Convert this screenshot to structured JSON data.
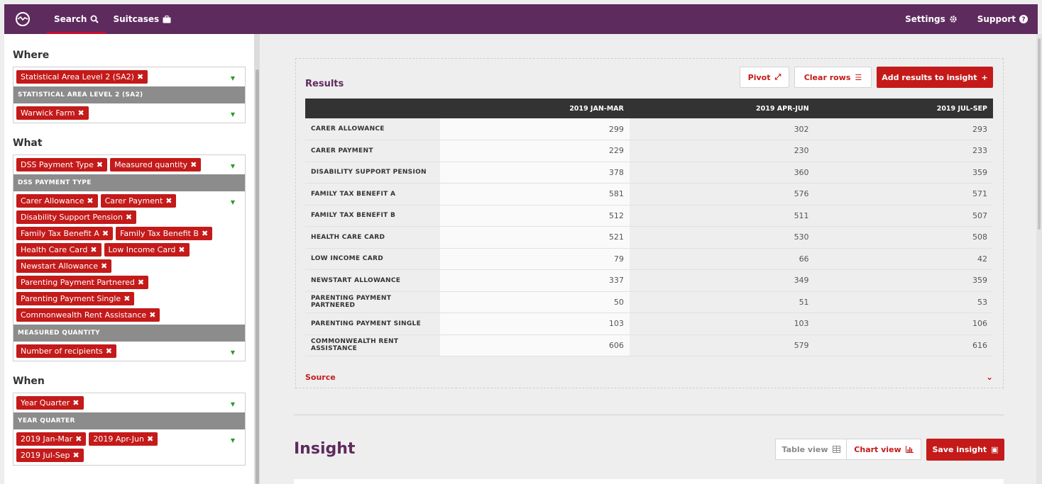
{
  "nav": {
    "search_label": "Search",
    "suitcases_label": "Suitcases",
    "settings_label": "Settings",
    "support_label": "Support",
    "active_color": "#c8102e",
    "bar_color": "#5e2b5e"
  },
  "sidebar": {
    "where": {
      "heading": "Where",
      "level_tags": [
        "Statistical Area Level 2 (SA2)"
      ],
      "group_label": "STATISTICAL AREA LEVEL 2 (SA2)",
      "area_tags": [
        "Warwick Farm"
      ]
    },
    "what": {
      "heading": "What",
      "dim_tags": [
        "DSS Payment Type",
        "Measured quantity"
      ],
      "group1_label": "DSS PAYMENT TYPE",
      "payment_tags": [
        "Carer Allowance",
        "Carer Payment",
        "Disability Support Pension",
        "Family Tax Benefit A",
        "Family Tax Benefit B",
        "Health Care Card",
        "Low Income Card",
        "Newstart Allowance",
        "Parenting Payment Partnered",
        "Parenting Payment Single",
        "Commonwealth Rent Assistance"
      ],
      "group2_label": "MEASURED QUANTITY",
      "quantity_tags": [
        "Number of recipients"
      ]
    },
    "when": {
      "heading": "When",
      "dim_tags": [
        "Year Quarter"
      ],
      "group_label": "YEAR QUARTER",
      "quarter_tags": [
        "2019 Jan-Mar",
        "2019 Apr-Jun",
        "2019 Jul-Sep"
      ]
    }
  },
  "results": {
    "title": "Results",
    "pivot_label": "Pivot",
    "clear_rows_label": "Clear rows",
    "add_label": "Add results to insight",
    "columns": [
      "",
      "2019 JAN-MAR",
      "2019 APR-JUN",
      "2019 JUL-SEP"
    ],
    "rows": [
      {
        "label": "CARER ALLOWANCE",
        "values": [
          "299",
          "302",
          "293"
        ]
      },
      {
        "label": "CARER PAYMENT",
        "values": [
          "229",
          "230",
          "233"
        ]
      },
      {
        "label": "DISABILITY SUPPORT PENSION",
        "values": [
          "378",
          "360",
          "359"
        ]
      },
      {
        "label": "FAMILY TAX BENEFIT A",
        "values": [
          "581",
          "576",
          "571"
        ]
      },
      {
        "label": "FAMILY TAX BENEFIT B",
        "values": [
          "512",
          "511",
          "507"
        ]
      },
      {
        "label": "HEALTH CARE CARD",
        "values": [
          "521",
          "530",
          "508"
        ]
      },
      {
        "label": "LOW INCOME CARD",
        "values": [
          "79",
          "66",
          "42"
        ]
      },
      {
        "label": "NEWSTART ALLOWANCE",
        "values": [
          "337",
          "349",
          "359"
        ]
      },
      {
        "label": "PARENTING PAYMENT PARTNERED",
        "values": [
          "50",
          "51",
          "53"
        ]
      },
      {
        "label": "PARENTING PAYMENT SINGLE",
        "values": [
          "103",
          "103",
          "106"
        ]
      },
      {
        "label": "COMMONWEALTH RENT ASSISTANCE",
        "values": [
          "606",
          "579",
          "616"
        ]
      }
    ],
    "source_label": "Source"
  },
  "insight": {
    "title": "Insight",
    "table_view_label": "Table view",
    "chart_view_label": "Chart view",
    "save_label": "Save insight"
  },
  "colors": {
    "accent": "#c41a1a",
    "brand": "#5e2b5e"
  }
}
